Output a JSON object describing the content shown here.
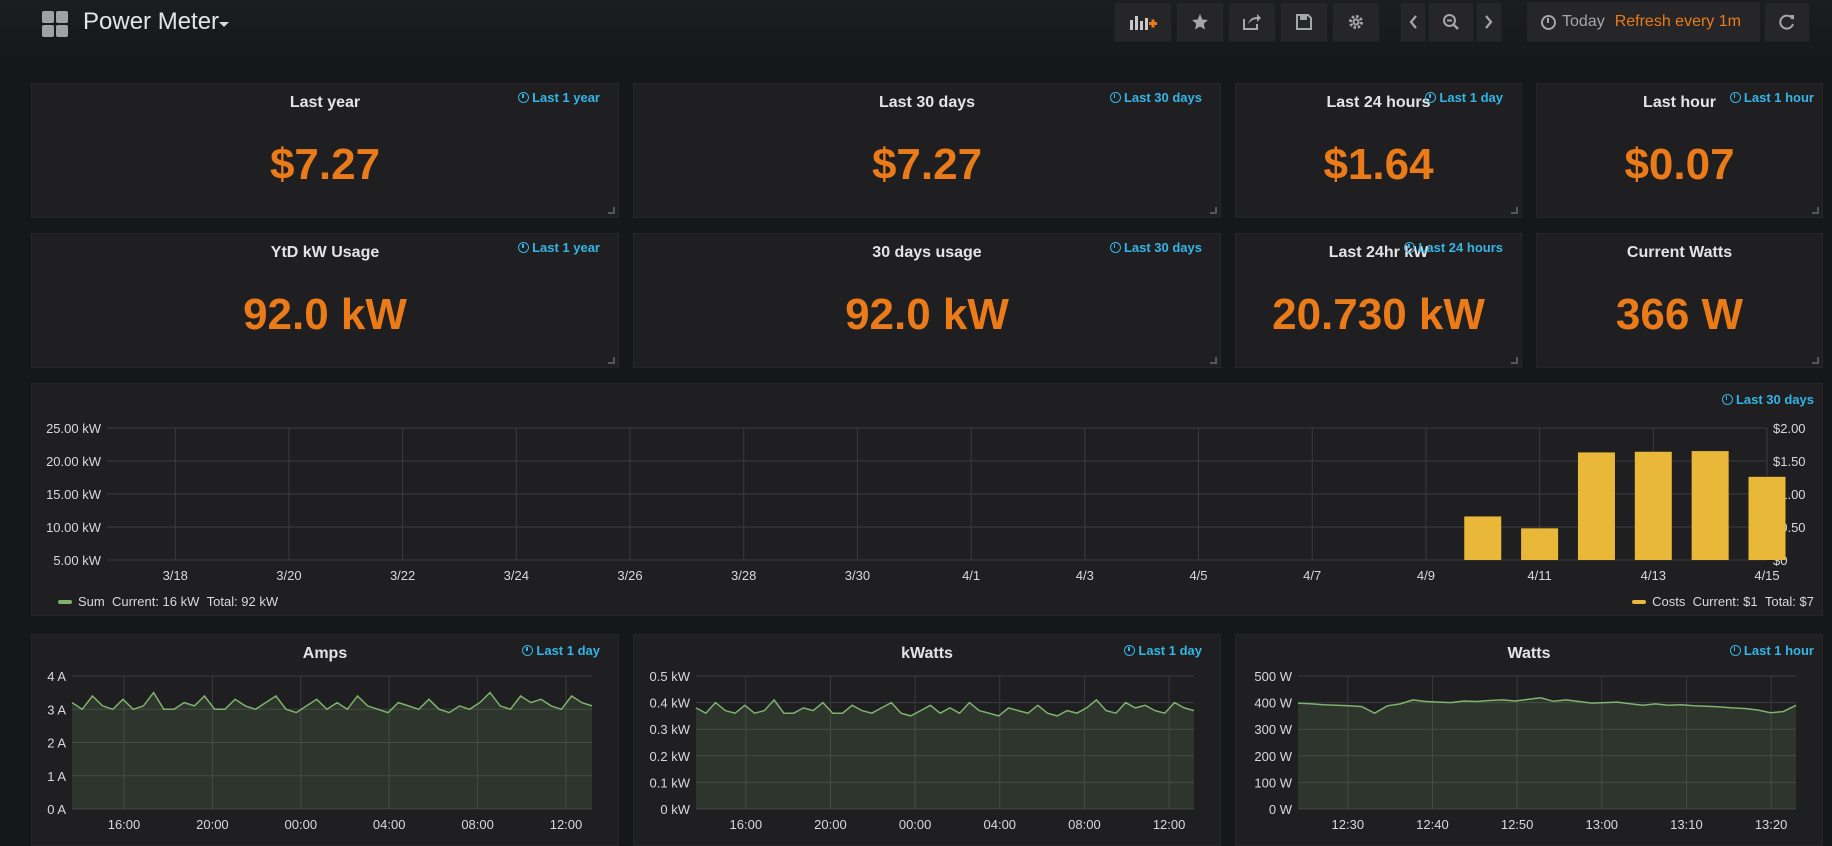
{
  "header": {
    "title": "Power Meter",
    "time_picker": {
      "range": "Today",
      "refresh": "Refresh every 1m"
    }
  },
  "stats_row1": [
    {
      "title": "Last year",
      "time": "Last 1 year",
      "value": "$7.27"
    },
    {
      "title": "Last 30 days",
      "time": "Last 30 days",
      "value": "$7.27"
    },
    {
      "title": "Last 24 hours",
      "time": "Last 1 day",
      "value": "$1.64"
    },
    {
      "title": "Last hour",
      "time": "Last 1 hour",
      "value": "$0.07"
    }
  ],
  "stats_row2": [
    {
      "title": "YtD kW Usage",
      "time": "Last 1 year",
      "value": "92.0 kW"
    },
    {
      "title": "30 days usage",
      "time": "Last 30 days",
      "value": "92.0 kW"
    },
    {
      "title": "Last 24hr kW",
      "time": "Last 24 hours",
      "value": "20.730 kW"
    },
    {
      "title": "Current Watts",
      "time": "",
      "value": "366 W"
    }
  ],
  "colors": {
    "accent": "#eb7b18",
    "time_link": "#33b5e5",
    "bar": "#eab839",
    "line": "#7eb26d"
  },
  "chart_data": [
    {
      "type": "bar",
      "time": "Last 30 days",
      "x_ticks": [
        "3/18",
        "3/20",
        "3/22",
        "3/24",
        "3/26",
        "3/28",
        "3/30",
        "4/1",
        "4/3",
        "4/5",
        "4/7",
        "4/9",
        "4/11",
        "4/13",
        "4/15"
      ],
      "y_ticks_left": [
        "5.00 kW",
        "10.00 kW",
        "15.00 kW",
        "20.00 kW",
        "25.00 kW"
      ],
      "y_ticks_right": [
        "$0",
        "$0.50",
        "$1.00",
        "$1.50",
        "$2.00"
      ],
      "ylim_cost": [
        0,
        2
      ],
      "series": [
        {
          "name": "Costs",
          "points": [
            {
              "x": "4/10",
              "value": 0.66
            },
            {
              "x": "4/11",
              "value": 0.48
            },
            {
              "x": "4/12",
              "value": 1.63
            },
            {
              "x": "4/13",
              "value": 1.64
            },
            {
              "x": "4/14",
              "value": 1.65
            },
            {
              "x": "4/15",
              "value": 1.26
            }
          ]
        }
      ],
      "legend_left": {
        "name": "Sum",
        "current": "Current: 16 kW",
        "total": "Total: 92 kW"
      },
      "legend_right": {
        "name": "Costs",
        "current": "Current: $1",
        "total": "Total: $7"
      }
    },
    {
      "type": "line",
      "title": "Amps",
      "time": "Last 1 day",
      "y_ticks": [
        "0 A",
        "1 A",
        "2 A",
        "3 A",
        "4 A"
      ],
      "ylim": [
        0,
        4
      ],
      "x_ticks": [
        "16:00",
        "20:00",
        "00:00",
        "04:00",
        "08:00",
        "12:00"
      ],
      "series": [
        {
          "values": [
            3.2,
            3.0,
            3.4,
            3.1,
            3.0,
            3.3,
            3.0,
            3.1,
            3.5,
            3.0,
            3.0,
            3.2,
            3.1,
            3.4,
            3.0,
            3.0,
            3.3,
            3.1,
            3.0,
            3.2,
            3.4,
            3.0,
            2.9,
            3.1,
            3.3,
            3.0,
            3.2,
            3.0,
            3.4,
            3.1,
            3.0,
            2.9,
            3.2,
            3.1,
            3.0,
            3.3,
            3.0,
            2.9,
            3.1,
            3.0,
            3.2,
            3.5,
            3.1,
            3.0,
            3.4,
            3.2,
            3.3,
            3.1,
            3.0,
            3.4,
            3.2,
            3.1
          ]
        }
      ]
    },
    {
      "type": "line",
      "title": "kWatts",
      "time": "Last 1 day",
      "y_ticks": [
        "0 kW",
        "0.1 kW",
        "0.2 kW",
        "0.3 kW",
        "0.4 kW",
        "0.5 kW"
      ],
      "ylim": [
        0,
        0.5
      ],
      "x_ticks": [
        "16:00",
        "20:00",
        "00:00",
        "04:00",
        "08:00",
        "12:00"
      ],
      "series": [
        {
          "values": [
            0.38,
            0.36,
            0.4,
            0.37,
            0.36,
            0.39,
            0.36,
            0.37,
            0.41,
            0.36,
            0.36,
            0.38,
            0.37,
            0.4,
            0.36,
            0.36,
            0.39,
            0.37,
            0.36,
            0.38,
            0.4,
            0.36,
            0.35,
            0.37,
            0.39,
            0.36,
            0.38,
            0.36,
            0.4,
            0.37,
            0.36,
            0.35,
            0.38,
            0.37,
            0.36,
            0.39,
            0.36,
            0.35,
            0.37,
            0.36,
            0.38,
            0.41,
            0.37,
            0.36,
            0.4,
            0.38,
            0.39,
            0.37,
            0.36,
            0.4,
            0.38,
            0.37
          ]
        }
      ]
    },
    {
      "type": "line",
      "title": "Watts",
      "time": "Last 1 hour",
      "y_ticks": [
        "0 W",
        "100 W",
        "200 W",
        "300 W",
        "400 W",
        "500 W"
      ],
      "ylim": [
        0,
        500
      ],
      "x_ticks": [
        "12:30",
        "12:40",
        "12:50",
        "13:00",
        "13:10",
        "13:20"
      ],
      "series": [
        {
          "values": [
            398,
            396,
            392,
            390,
            388,
            385,
            360,
            388,
            395,
            410,
            404,
            402,
            400,
            406,
            404,
            408,
            410,
            406,
            412,
            418,
            405,
            410,
            404,
            398,
            400,
            402,
            396,
            390,
            395,
            390,
            392,
            388,
            386,
            384,
            380,
            378,
            372,
            362,
            366,
            390
          ]
        }
      ]
    }
  ]
}
